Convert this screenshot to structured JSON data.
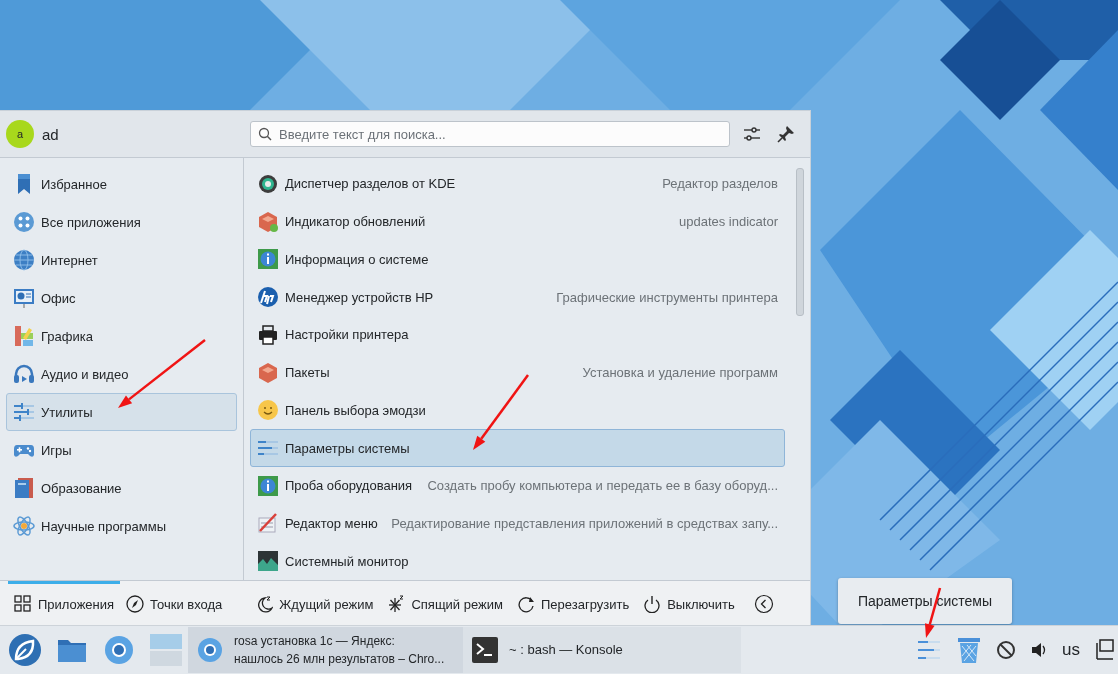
{
  "user": {
    "avatar_letter": "a",
    "name": "ad"
  },
  "search": {
    "placeholder": "Введите текст для поиска..."
  },
  "categories": [
    {
      "label": "Избранное",
      "selected": false
    },
    {
      "label": "Все приложения",
      "selected": false
    },
    {
      "label": "Интернет",
      "selected": false
    },
    {
      "label": "Офис",
      "selected": false
    },
    {
      "label": "Графика",
      "selected": false
    },
    {
      "label": "Аудио и видео",
      "selected": false
    },
    {
      "label": "Утилиты",
      "selected": true
    },
    {
      "label": "Игры",
      "selected": false
    },
    {
      "label": "Образование",
      "selected": false
    },
    {
      "label": "Научные программы",
      "selected": false
    }
  ],
  "apps": [
    {
      "name": "Диспетчер разделов от KDE",
      "description": "Редактор разделов",
      "selected": false
    },
    {
      "name": "Индикатор обновлений",
      "description": "updates indicator",
      "selected": false
    },
    {
      "name": "Информация о системе",
      "selected": false
    },
    {
      "name": "Менеджер устройств HP",
      "description": "Графические инструменты принтера",
      "selected": false
    },
    {
      "name": "Настройки принтера",
      "selected": false
    },
    {
      "name": "Пакеты",
      "description": "Установка и удаление программ",
      "selected": false
    },
    {
      "name": "Панель выбора эмодзи",
      "selected": false
    },
    {
      "name": "Параметры системы",
      "selected": true
    },
    {
      "name": "Проба оборудования",
      "description": "Создать пробу компьютера и передать ее в базу оборуд...",
      "selected": false
    },
    {
      "name": "Редактор меню",
      "description": "Редактирование представления приложений в средствах запу...",
      "selected": false
    },
    {
      "name": "Системный монитор",
      "selected": false
    }
  ],
  "footer_tabs": [
    {
      "label": "Приложения",
      "selected": true
    },
    {
      "label": "Точки входа",
      "selected": false
    }
  ],
  "power_actions": [
    "Ждущий режим",
    "Спящий режим",
    "Перезагрузить",
    "Выключить"
  ],
  "tooltip": "Параметры системы",
  "tasks": [
    {
      "title": "rosa установка 1с — Яндекс:\nнашлось 26 млн результатов – Chro...",
      "active": true
    },
    {
      "title": "~ : bash — Konsole",
      "active": false
    }
  ],
  "tray": {
    "keyboard_layout": "us"
  }
}
